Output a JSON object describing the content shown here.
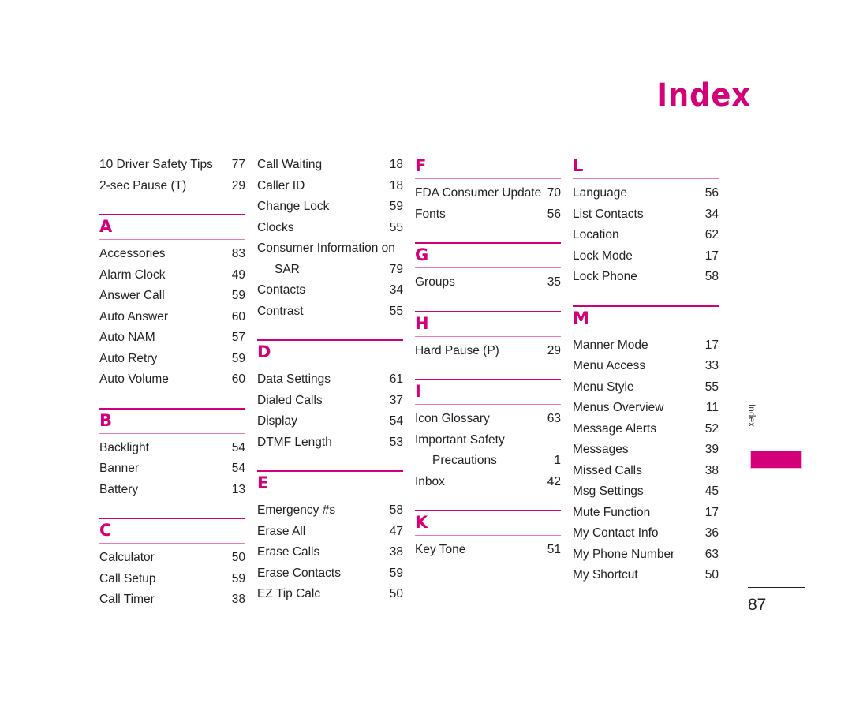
{
  "page": {
    "title": "Index",
    "number": "87",
    "side_tab_label": "Index",
    "accent_color": "#d4007a",
    "rule_thick_color": "#cf0079",
    "rule_thin_color": "#e87bb4",
    "text_color": "#231f20"
  },
  "columns": [
    {
      "sections": [
        {
          "letter": "",
          "show_letter": false,
          "show_rule_above": false,
          "entries": [
            {
              "label": "10 Driver Safety Tips",
              "page": "77"
            },
            {
              "label": "2-sec Pause (T)",
              "page": "29"
            }
          ]
        },
        {
          "letter": "A",
          "show_letter": true,
          "show_rule_above": true,
          "entries": [
            {
              "label": "Accessories",
              "page": "83"
            },
            {
              "label": "Alarm Clock",
              "page": "49"
            },
            {
              "label": "Answer Call",
              "page": "59"
            },
            {
              "label": "Auto Answer",
              "page": "60"
            },
            {
              "label": "Auto NAM",
              "page": "57"
            },
            {
              "label": "Auto Retry",
              "page": "59"
            },
            {
              "label": "Auto Volume",
              "page": "60"
            }
          ]
        },
        {
          "letter": "B",
          "show_letter": true,
          "show_rule_above": true,
          "entries": [
            {
              "label": "Backlight",
              "page": "54"
            },
            {
              "label": "Banner",
              "page": "54"
            },
            {
              "label": "Battery",
              "page": "13"
            }
          ]
        },
        {
          "letter": "C",
          "show_letter": true,
          "show_rule_above": true,
          "entries": [
            {
              "label": "Calculator",
              "page": "50"
            },
            {
              "label": "Call Setup",
              "page": "59"
            },
            {
              "label": "Call Timer",
              "page": "38"
            }
          ]
        }
      ]
    },
    {
      "sections": [
        {
          "letter": "",
          "show_letter": false,
          "show_rule_above": false,
          "entries": [
            {
              "label": "Call Waiting",
              "page": "18"
            },
            {
              "label": "Caller ID",
              "page": "18"
            },
            {
              "label": "Change Lock",
              "page": "59"
            },
            {
              "label": "Clocks",
              "page": "55"
            },
            {
              "label": "Consumer Information on",
              "label2": "SAR",
              "page": "79",
              "wrapped": true
            },
            {
              "label": "Contacts",
              "page": "34"
            },
            {
              "label": "Contrast",
              "page": "55"
            }
          ]
        },
        {
          "letter": "D",
          "show_letter": true,
          "show_rule_above": true,
          "entries": [
            {
              "label": "Data Settings",
              "page": "61"
            },
            {
              "label": "Dialed Calls",
              "page": "37"
            },
            {
              "label": "Display",
              "page": "54"
            },
            {
              "label": "DTMF Length",
              "page": "53"
            }
          ]
        },
        {
          "letter": "E",
          "show_letter": true,
          "show_rule_above": true,
          "entries": [
            {
              "label": "Emergency #s",
              "page": "58"
            },
            {
              "label": "Erase All",
              "page": "47"
            },
            {
              "label": "Erase Calls",
              "page": "38"
            },
            {
              "label": "Erase Contacts",
              "page": "59"
            },
            {
              "label": "EZ Tip Calc",
              "page": "50"
            }
          ]
        }
      ]
    },
    {
      "sections": [
        {
          "letter": "F",
          "show_letter": true,
          "show_rule_above": false,
          "entries": [
            {
              "label": "FDA Consumer Update",
              "page": "70"
            },
            {
              "label": "Fonts",
              "page": "56"
            }
          ]
        },
        {
          "letter": "G",
          "show_letter": true,
          "show_rule_above": true,
          "entries": [
            {
              "label": "Groups",
              "page": "35"
            }
          ]
        },
        {
          "letter": "H",
          "show_letter": true,
          "show_rule_above": true,
          "entries": [
            {
              "label": "Hard Pause (P)",
              "page": "29"
            }
          ]
        },
        {
          "letter": "I",
          "show_letter": true,
          "show_rule_above": true,
          "entries": [
            {
              "label": "Icon Glossary",
              "page": "63"
            },
            {
              "label": "Important Safety",
              "label2": "Precautions",
              "page": "1",
              "wrapped": true
            },
            {
              "label": "Inbox",
              "page": "42"
            }
          ]
        },
        {
          "letter": "K",
          "show_letter": true,
          "show_rule_above": true,
          "entries": [
            {
              "label": "Key Tone",
              "page": "51"
            }
          ]
        }
      ]
    },
    {
      "sections": [
        {
          "letter": "L",
          "show_letter": true,
          "show_rule_above": false,
          "entries": [
            {
              "label": "Language",
              "page": "56"
            },
            {
              "label": "List Contacts",
              "page": "34"
            },
            {
              "label": "Location",
              "page": "62"
            },
            {
              "label": "Lock Mode",
              "page": "17"
            },
            {
              "label": "Lock Phone",
              "page": "58"
            }
          ]
        },
        {
          "letter": "M",
          "show_letter": true,
          "show_rule_above": true,
          "entries": [
            {
              "label": "Manner Mode",
              "page": "17"
            },
            {
              "label": "Menu Access",
              "page": "33"
            },
            {
              "label": "Menu Style",
              "page": "55"
            },
            {
              "label": "Menus Overview",
              "page": "11"
            },
            {
              "label": "Message Alerts",
              "page": "52"
            },
            {
              "label": "Messages",
              "page": "39"
            },
            {
              "label": "Missed Calls",
              "page": "38"
            },
            {
              "label": "Msg Settings",
              "page": "45"
            },
            {
              "label": "Mute Function",
              "page": "17"
            },
            {
              "label": "My Contact Info",
              "page": "36"
            },
            {
              "label": "My Phone Number",
              "page": "63"
            },
            {
              "label": "My Shortcut",
              "page": "50"
            }
          ]
        }
      ]
    }
  ]
}
